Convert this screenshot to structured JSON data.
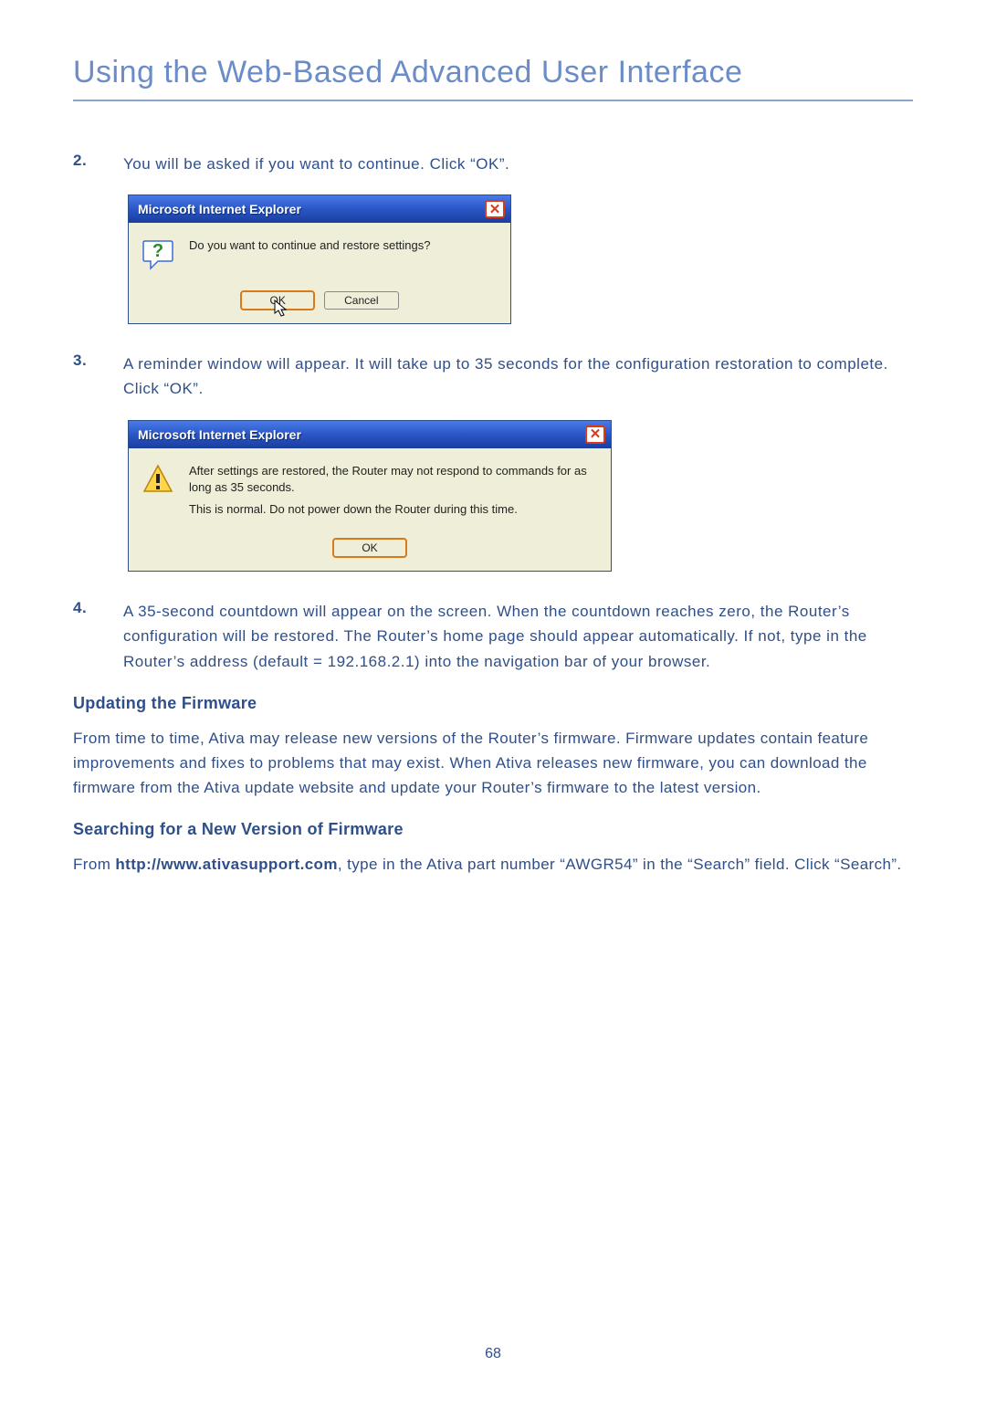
{
  "page_title": "Using the Web-Based Advanced User Interface",
  "steps": {
    "s2": {
      "num": "2.",
      "text": "You will be asked if you want to continue. Click “OK”."
    },
    "s3": {
      "num": "3.",
      "text": "A reminder window will appear. It will take up to 35 seconds for the configuration restoration to complete. Click “OK”."
    },
    "s4": {
      "num": "4.",
      "text": "A 35-second countdown will appear on the screen. When the countdown reaches zero, the Router’s configuration will be restored. The Router’s home page should appear automatically. If not, type in the Router’s address (default = 192.168.2.1) into the navigation bar of your browser."
    }
  },
  "dialog1": {
    "title": "Microsoft Internet Explorer",
    "message": "Do you want to continue and restore settings?",
    "ok": "OK",
    "cancel": "Cancel"
  },
  "dialog2": {
    "title": "Microsoft Internet Explorer",
    "line1": "After settings are restored, the Router may not respond to commands for as long as 35 seconds.",
    "line2": "This is normal. Do not power down the Router during this time.",
    "ok": "OK"
  },
  "sections": {
    "updating": {
      "heading": "Updating the Firmware",
      "body": "From time to time, Ativa may release new versions of the Router’s firmware. Firmware updates contain feature improvements and fixes to problems that may exist. When Ativa releases new firmware, you can download the firmware from the Ativa update website and update your Router’s firmware to the latest version."
    },
    "searching": {
      "heading": "Searching for a New Version of Firmware",
      "prefix": "From ",
      "bold": "http://www.ativasupport.com",
      "suffix": ", type in the Ativa part number “AWGR54” in the “Search” field. Click “Search”."
    }
  },
  "page_number": "68"
}
